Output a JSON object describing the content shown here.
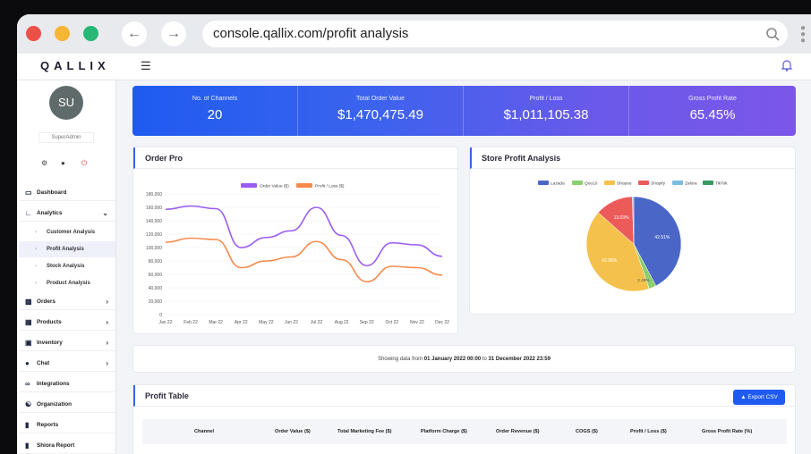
{
  "browser": {
    "url": "console.qallix.com/profit analysis"
  },
  "app": {
    "logo": "QALLIX"
  },
  "user": {
    "initials": "SU",
    "role": "SuperAdmin"
  },
  "sidebar": {
    "items": [
      {
        "label": "Dashboard"
      },
      {
        "label": "Analytics"
      },
      {
        "label": "Orders"
      },
      {
        "label": "Products"
      },
      {
        "label": "Inventory"
      },
      {
        "label": "Chat"
      },
      {
        "label": "Integrations"
      },
      {
        "label": "Organization"
      },
      {
        "label": "Reports"
      },
      {
        "label": "Shiora Report"
      }
    ],
    "analytics_sub": [
      {
        "label": "Customer Analysis"
      },
      {
        "label": "Profit Analysis"
      },
      {
        "label": "Stock Analysis"
      },
      {
        "label": "Product Analysis"
      }
    ]
  },
  "kpis": [
    {
      "label": "No. of Channels",
      "value": "20"
    },
    {
      "label": "Total Order Value",
      "value": "$1,470,475.49"
    },
    {
      "label": "Profit / Loss",
      "value": "$1,011,105.38"
    },
    {
      "label": "Gross Profit Rate",
      "value": "65.45%"
    }
  ],
  "order_card": {
    "title": "Order Pro"
  },
  "store_card": {
    "title": "Store Profit Analysis"
  },
  "range": {
    "prefix": "Showing data from ",
    "start": "01 January 2022 00:00",
    "mid": " to ",
    "end": "31 December 2022 23:59"
  },
  "profit_table": {
    "title": "Profit Table",
    "export_label": "Export CSV",
    "columns": [
      "Channel",
      "Order Value ($)",
      "Total Marketing Fee ($)",
      "Platform Charge ($)",
      "Order Revenue ($)",
      "COGS ($)",
      "Profit / Loss ($)",
      "Gross Profit Rate (%)"
    ]
  },
  "chart_data": [
    {
      "type": "line",
      "categories": [
        "Jan 22",
        "Feb 22",
        "Mar 22",
        "Apr 22",
        "May 22",
        "Jun 22",
        "Jul 22",
        "Aug 22",
        "Sep 22",
        "Oct 22",
        "Nov 22",
        "Dec 22"
      ],
      "series": [
        {
          "name": "Order Value ($)",
          "values": [
            157000,
            162000,
            158000,
            100000,
            115000,
            125000,
            160000,
            118000,
            73000,
            107000,
            104000,
            87000
          ],
          "color": "#9b5cf0"
        },
        {
          "name": "Profit / Loss ($)",
          "values": [
            108000,
            114000,
            112000,
            70000,
            80000,
            86000,
            109000,
            82000,
            49000,
            72000,
            70000,
            59000
          ],
          "color": "#f58a4b"
        }
      ],
      "yticks": [
        "0",
        "20,000",
        "40,000",
        "60,000",
        "80,000",
        "100,000",
        "120,000",
        "140,000",
        "160,000",
        "180,000"
      ],
      "ylim": [
        0,
        180000
      ],
      "legend": "top"
    },
    {
      "type": "pie",
      "labels": [
        "Lazada",
        "Qoo10",
        "Shopee",
        "Shopify",
        "Zalora",
        "TikTok"
      ],
      "colors": [
        "#4a67c8",
        "#8bcf6f",
        "#f4c24c",
        "#ec5a5a",
        "#7dbbe0",
        "#3a9a62"
      ],
      "values": [
        42.51,
        2.49,
        42.08,
        13.03,
        0.5,
        0
      ],
      "slice_labels": [
        "42.51%",
        "",
        "42.08%",
        "13.03%",
        "",
        ""
      ],
      "small_label": "2.49%",
      "legend": "top"
    }
  ]
}
